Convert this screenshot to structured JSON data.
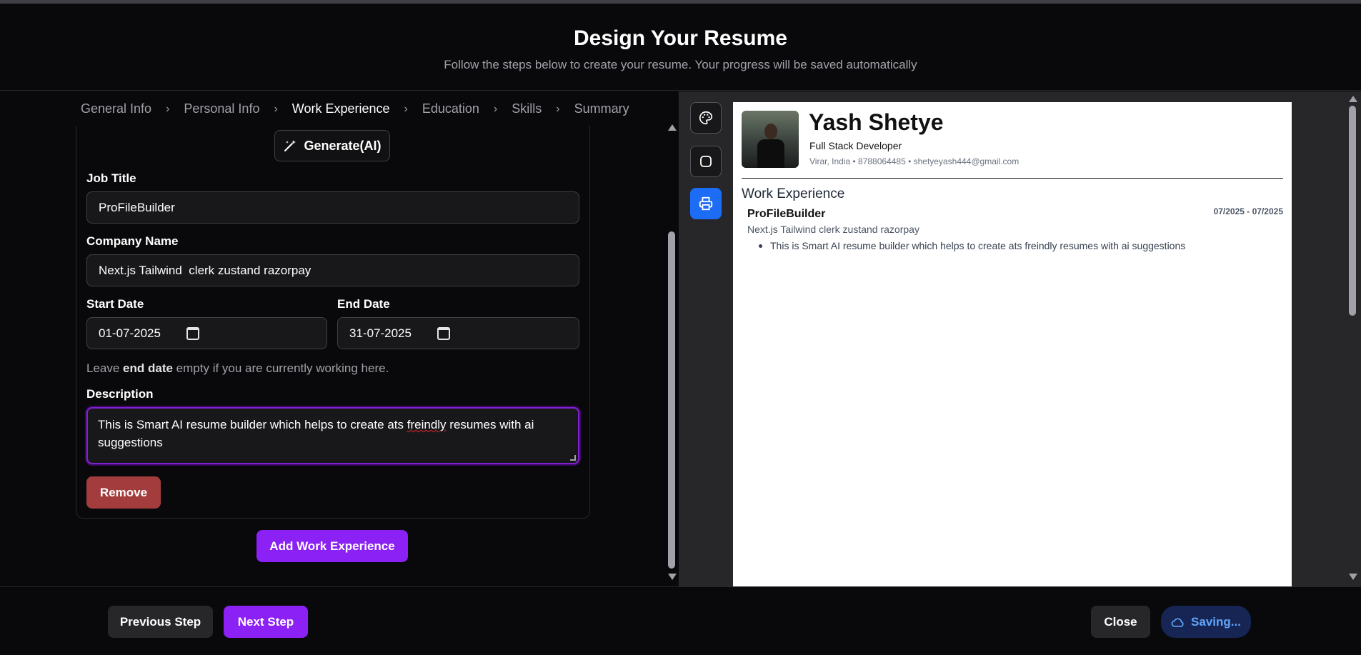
{
  "header": {
    "title": "Design Your Resume",
    "subtitle": "Follow the steps below to create your resume. Your progress will be saved automatically"
  },
  "steps": [
    {
      "label": "General Info"
    },
    {
      "label": "Personal Info"
    },
    {
      "label": "Work Experience",
      "active": true
    },
    {
      "label": "Education"
    },
    {
      "label": "Skills"
    },
    {
      "label": "Summary"
    }
  ],
  "form": {
    "generate_label": "Generate(AI)",
    "job_title_label": "Job Title",
    "job_title_value": "ProFileBuilder",
    "company_label": "Company Name",
    "company_value": "Next.js Tailwind  clerk zustand razorpay",
    "start_label": "Start Date",
    "start_value": "01-07-2025",
    "end_label": "End Date",
    "end_value": "31-07-2025",
    "hint_pre": "Leave ",
    "hint_bold": "end date",
    "hint_post": " empty if you are currently working here.",
    "description_label": "Description",
    "description_pre": "This is Smart AI resume builder which helps to create ats ",
    "description_misspelled": "freindly",
    "description_post": " resumes with ai suggestions",
    "remove_label": "Remove",
    "add_label": "Add Work Experience"
  },
  "toolbar": {
    "icons": [
      "palette-icon",
      "square-icon",
      "printer-icon"
    ]
  },
  "preview": {
    "name": "Yash Shetye",
    "role": "Full Stack Developer",
    "contact": "Virar, India • 8788064485 • shetyeyash444@gmail.com",
    "section_title": "Work Experience",
    "job_title": "ProFileBuilder",
    "dates": "07/2025 - 07/2025",
    "company": "Next.js Tailwind clerk zustand razorpay",
    "bullet": "This is Smart AI resume builder which helps to create ats freindly resumes with ai suggestions"
  },
  "footer": {
    "prev_label": "Previous Step",
    "next_label": "Next Step",
    "close_label": "Close",
    "saving_label": "Saving..."
  },
  "colors": {
    "accent": "#8b21f5",
    "print_active": "#1d6cf5",
    "remove": "#a33d3d",
    "saving_text": "#60a5fa"
  }
}
